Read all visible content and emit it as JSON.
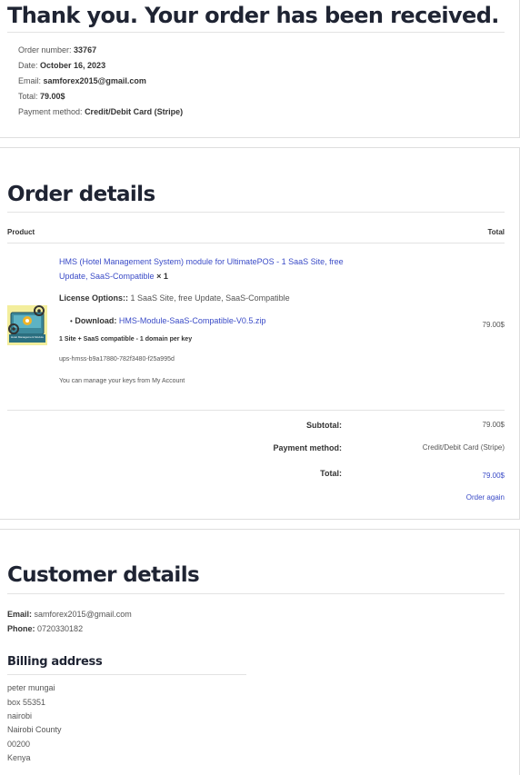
{
  "thank_you": {
    "title": "Thank you. Your order has been received.",
    "order_number_label": "Order number:",
    "order_number": "33767",
    "date_label": "Date:",
    "date": "October 16, 2023",
    "email_label": "Email:",
    "email": "samforex2015@gmail.com",
    "total_label": "Total:",
    "total": "79.00$",
    "payment_label": "Payment method:",
    "payment": "Credit/Debit Card (Stripe)"
  },
  "order_details": {
    "title": "Order details",
    "col_product": "Product",
    "col_total": "Total",
    "product_name_line1": "HMS (Hotel Management System) module for UltimatePOS - 1 SaaS Site, free",
    "product_name_line2": "Update, SaaS-Compatible",
    "product_qty": "× 1",
    "license_label": "License Options::",
    "license_value": "1 SaaS Site, free Update, SaaS-Compatible",
    "download_label": "Download:",
    "download_file": "HMS-Module-SaaS-Compatible-V0.5.zip",
    "key_type": "1 Site + SaaS compatible - 1 domain per key",
    "key_value": "ups-hmss-b9a17880-782f3480-f25a995d",
    "manage_keys": "You can manage your keys from My Account",
    "line_total": "79.00$",
    "subtotal_label": "Subtotal:",
    "subtotal": "79.00$",
    "payment_label": "Payment method:",
    "payment": "Credit/Debit Card (Stripe)",
    "total_label": "Total:",
    "total": "79.00$",
    "order_again": "Order again",
    "thumb_caption": "Hotel Management Module"
  },
  "customer_details": {
    "title": "Customer details",
    "email_label": "Email:",
    "email": "samforex2015@gmail.com",
    "phone_label": "Phone:",
    "phone": "0720330182",
    "billing_title": "Billing address",
    "address": [
      "peter mungai",
      "box 55351",
      "nairobi",
      "Nairobi County",
      "00200",
      "Kenya"
    ]
  }
}
